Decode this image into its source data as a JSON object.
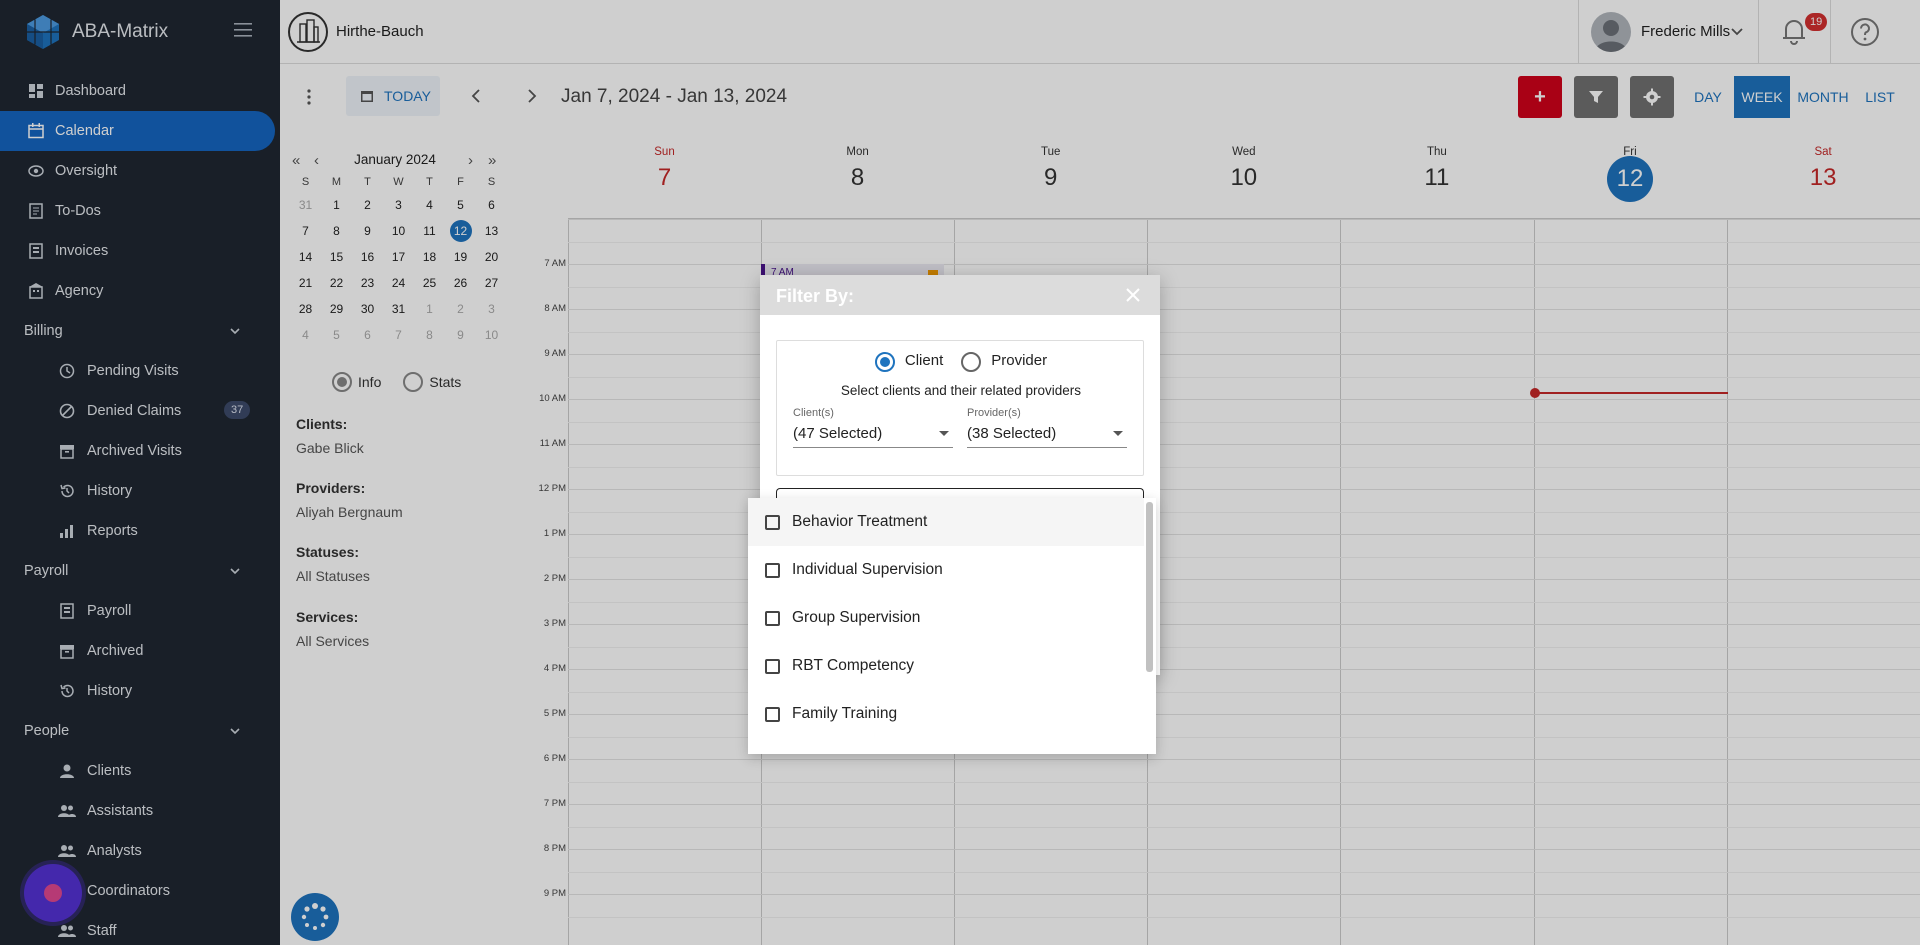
{
  "app": {
    "name": "ABA-Matrix",
    "org_name": "Hirthe-Bauch"
  },
  "user": {
    "name": "Frederic Mills",
    "notifications": "19"
  },
  "sidebar": {
    "top_items": [
      {
        "label": "Dashboard",
        "icon": "dashboard-icon"
      },
      {
        "label": "Calendar",
        "icon": "calendar-icon",
        "active": true
      },
      {
        "label": "Oversight",
        "icon": "eye-icon"
      },
      {
        "label": "To-Dos",
        "icon": "todo-icon"
      },
      {
        "label": "Invoices",
        "icon": "invoice-icon"
      },
      {
        "label": "Agency",
        "icon": "agency-icon"
      }
    ],
    "billing": {
      "label": "Billing",
      "items": [
        {
          "label": "Pending Visits"
        },
        {
          "label": "Denied Claims",
          "badge": "37"
        },
        {
          "label": "Archived Visits"
        },
        {
          "label": "History"
        },
        {
          "label": "Reports"
        }
      ]
    },
    "payroll": {
      "label": "Payroll",
      "items": [
        {
          "label": "Payroll"
        },
        {
          "label": "Archived"
        },
        {
          "label": "History"
        }
      ]
    },
    "people": {
      "label": "People",
      "items": [
        {
          "label": "Clients"
        },
        {
          "label": "Assistants"
        },
        {
          "label": "Analysts"
        },
        {
          "label": "Coordinators"
        },
        {
          "label": "Staff"
        }
      ]
    }
  },
  "toolbar": {
    "today_label": "TODAY",
    "date_range": "Jan 7, 2024 - Jan 13, 2024",
    "add_label": "+",
    "views": {
      "day": "DAY",
      "week": "WEEK",
      "month": "MONTH",
      "list": "LIST"
    },
    "active_view": "WEEK"
  },
  "mini_calendar": {
    "month_label": "January 2024",
    "weekdays": [
      "S",
      "M",
      "T",
      "W",
      "T",
      "F",
      "S"
    ],
    "weeks": [
      [
        "31",
        "1",
        "2",
        "3",
        "4",
        "5",
        "6"
      ],
      [
        "7",
        "8",
        "9",
        "10",
        "11",
        "12",
        "13"
      ],
      [
        "14",
        "15",
        "16",
        "17",
        "18",
        "19",
        "20"
      ],
      [
        "21",
        "22",
        "23",
        "24",
        "25",
        "26",
        "27"
      ],
      [
        "28",
        "29",
        "30",
        "31",
        "1",
        "2",
        "3"
      ],
      [
        "4",
        "5",
        "6",
        "7",
        "8",
        "9",
        "10"
      ]
    ],
    "selected_day": "12"
  },
  "info_panel": {
    "info_label": "Info",
    "stats_label": "Stats",
    "clients_label": "Clients:",
    "clients_value": "Gabe Blick",
    "providers_label": "Providers:",
    "providers_value": "Aliyah Bergnaum",
    "statuses_label": "Statuses:",
    "statuses_value": "All Statuses",
    "services_label": "Services:",
    "services_value": "All Services"
  },
  "week": {
    "days": [
      {
        "name": "Sun",
        "date": "7"
      },
      {
        "name": "Mon",
        "date": "8"
      },
      {
        "name": "Tue",
        "date": "9"
      },
      {
        "name": "Wed",
        "date": "10"
      },
      {
        "name": "Thu",
        "date": "11"
      },
      {
        "name": "Fri",
        "date": "12"
      },
      {
        "name": "Sat",
        "date": "13"
      }
    ],
    "hours": [
      "7 AM",
      "8 AM",
      "9 AM",
      "10 AM",
      "11 AM",
      "12 PM",
      "1 PM",
      "2 PM",
      "3 PM",
      "4 PM",
      "5 PM",
      "6 PM",
      "7 PM",
      "8 PM",
      "9 PM"
    ],
    "event_label": "7 AM"
  },
  "filter_dialog": {
    "title": "Filter By:",
    "client_option": "Client",
    "provider_option": "Provider",
    "selected_type": "Client",
    "hint": "Select clients and their related providers",
    "clients_label": "Client(s)",
    "clients_value": "(47 Selected)",
    "providers_label": "Provider(s)",
    "providers_value": "(38 Selected)"
  },
  "service_dropdown": {
    "options": [
      "Behavior Treatment",
      "Individual Supervision",
      "Group Supervision",
      "RBT Competency",
      "Family Training"
    ]
  },
  "colors": {
    "sidebar_bg": "#1f2732",
    "accent": "#1e73be",
    "danger": "#d0021b",
    "weekend": "#c62828"
  }
}
